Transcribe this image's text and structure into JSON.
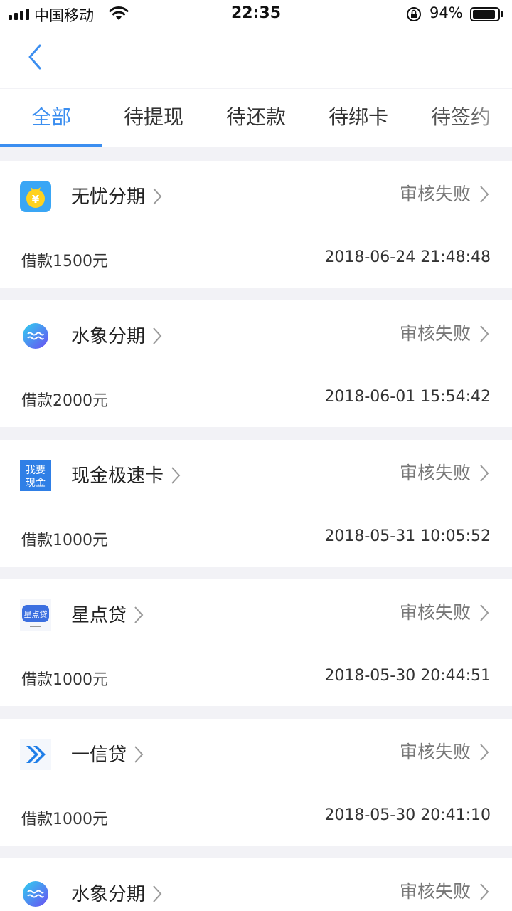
{
  "status_bar": {
    "carrier": "中国移动",
    "time": "22:35",
    "battery": "94%"
  },
  "tabs": [
    {
      "label": "全部",
      "active": true
    },
    {
      "label": "待提现",
      "active": false
    },
    {
      "label": "待还款",
      "active": false
    },
    {
      "label": "待绑卡",
      "active": false
    },
    {
      "label": "待签约",
      "active": false
    }
  ],
  "colors": {
    "accent": "#3b8ef0",
    "background": "#f2f2f6"
  },
  "loans": [
    {
      "name": "无忧分期",
      "logo": "money-bag-icon",
      "status": "审核失败",
      "amount": "借款1500元",
      "datetime": "2018-06-24 21:48:48"
    },
    {
      "name": "水象分期",
      "logo": "water-wave-icon",
      "status": "审核失败",
      "amount": "借款2000元",
      "datetime": "2018-06-01 15:54:42"
    },
    {
      "name": "现金极速卡",
      "logo": "cash-text-icon",
      "logo_text": [
        "我要",
        "现金"
      ],
      "status": "审核失败",
      "amount": "借款1000元",
      "datetime": "2018-05-31 10:05:52"
    },
    {
      "name": "星点贷",
      "logo": "star-loan-icon",
      "logo_text": [
        "星点贷"
      ],
      "status": "审核失败",
      "amount": "借款1000元",
      "datetime": "2018-05-30 20:44:51"
    },
    {
      "name": "一信贷",
      "logo": "double-chevron-icon",
      "status": "审核失败",
      "amount": "借款1000元",
      "datetime": "2018-05-30 20:41:10"
    },
    {
      "name": "水象分期",
      "logo": "water-wave-icon",
      "status": "审核失败",
      "amount": "",
      "datetime": ""
    }
  ]
}
